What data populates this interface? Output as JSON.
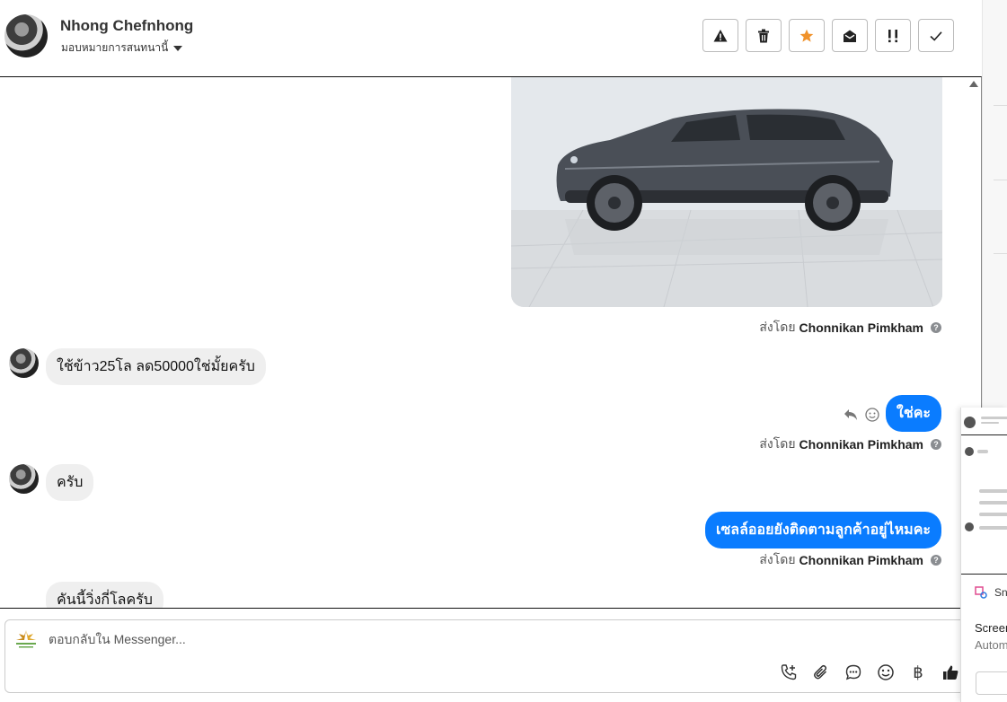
{
  "header": {
    "contact_name": "Nhong Chefnhong",
    "assign_label": "มอบหมายการสนทนานี้"
  },
  "toolbar": [
    {
      "name": "spam-button",
      "icon": "warning-icon",
      "glyph": "⚠"
    },
    {
      "name": "delete-button",
      "icon": "trash-icon",
      "glyph": "🗑"
    },
    {
      "name": "star-button",
      "icon": "star-icon",
      "glyph": "★"
    },
    {
      "name": "mark-unread-button",
      "icon": "envelope-open-icon",
      "glyph": "✉"
    },
    {
      "name": "follow-up-button",
      "icon": "important-icon",
      "glyph": "!!"
    },
    {
      "name": "done-button",
      "icon": "check-icon",
      "glyph": "✓"
    }
  ],
  "messages": {
    "sent_by_prefix": "ส่งโดย",
    "agent_name": "Chonnikan Pimkham",
    "m1_in": "ใช้ข้าว25โล ลด50000ใช่มั้ยครับ",
    "m2_out": "ใช่คะ",
    "m3_in": "ครับ",
    "m4_out": "เซลล์ออยยังติดตามลูกค้าอยู่ไหมคะ",
    "m5_in": "คันนี้วิ่งกี่โลครับ"
  },
  "composer": {
    "placeholder": "ตอบกลับใน Messenger...",
    "icons": [
      "add-call-icon",
      "attach-icon",
      "saved-replies-icon",
      "emoji-icon",
      "baht-icon",
      "like-icon"
    ],
    "baht_glyph": "฿"
  },
  "side_panel": {
    "sn_label": "Sn",
    "screen_label": "Screer",
    "auto_label": "Autom"
  },
  "colors": {
    "accent_blue": "#0a7cff",
    "incoming_bubble": "#efefef",
    "star_orange": "#f0922b"
  }
}
